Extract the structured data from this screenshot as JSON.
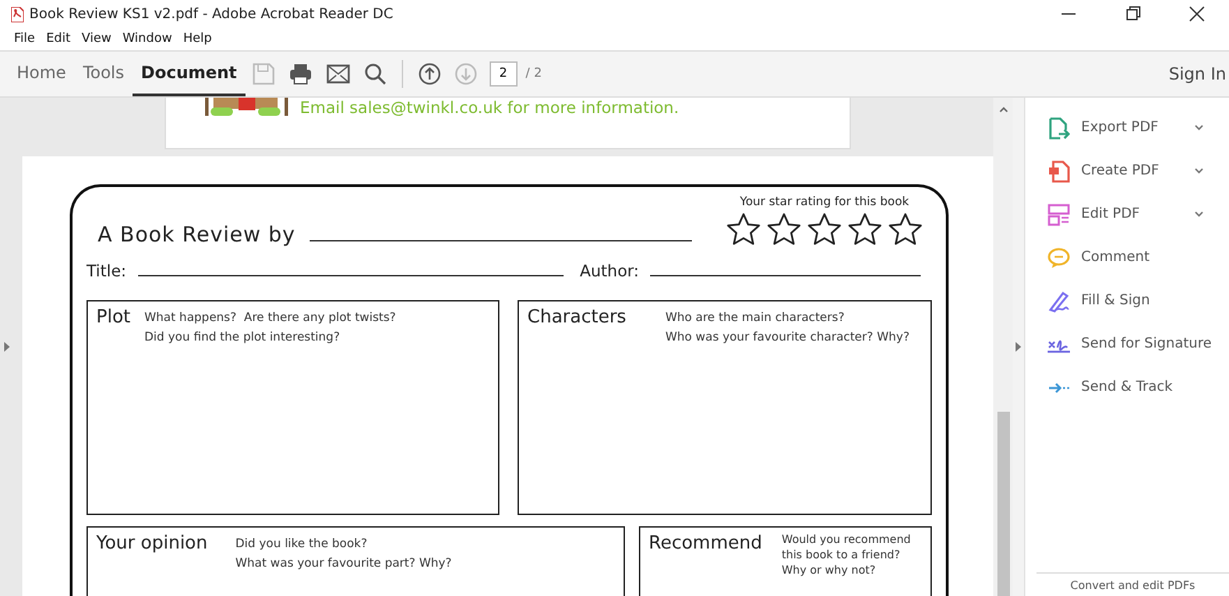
{
  "window": {
    "title": "Book Review KS1 v2.pdf - Adobe Acrobat Reader DC"
  },
  "menu": [
    "File",
    "Edit",
    "View",
    "Window",
    "Help"
  ],
  "tabs": [
    {
      "label": "Home",
      "selected": false
    },
    {
      "label": "Tools",
      "selected": false
    },
    {
      "label": "Document",
      "selected": true
    }
  ],
  "page_nav": {
    "current": "2",
    "total": "/ 2"
  },
  "sign_in": "Sign In",
  "previous_page": {
    "text": "Email sales@twinkl.co.uk for more information."
  },
  "review_sheet": {
    "heading": "A Book Review by",
    "star_prompt": "Your star rating for this book",
    "stars": 0,
    "title_label": "Title:",
    "author_label": "Author:",
    "sections": [
      {
        "title": "Plot",
        "prompts": [
          "What happens?  Are there any plot twists?",
          "Did you find the plot interesting?"
        ]
      },
      {
        "title": "Characters",
        "prompts": [
          "Who are the main characters?",
          "Who was your favourite character? Why?"
        ]
      },
      {
        "title": "Your opinion",
        "prompts": [
          "Did you like the book?",
          "What was your favourite part? Why?"
        ]
      },
      {
        "title": "Recommend",
        "prompts": [
          "Would you recommend",
          "this book to a friend?",
          "Why or why not?"
        ]
      }
    ]
  },
  "tools_pane": {
    "items": [
      {
        "label": "Export PDF",
        "kind": "export",
        "color": "#2fa37f",
        "has_menu": true
      },
      {
        "label": "Create PDF",
        "kind": "create",
        "color": "#e8584b",
        "has_menu": true
      },
      {
        "label": "Edit PDF",
        "kind": "edit",
        "color": "#d55fd0",
        "has_menu": true
      },
      {
        "label": "Comment",
        "kind": "comment",
        "color": "#f0b429",
        "has_menu": false
      },
      {
        "label": "Fill & Sign",
        "kind": "sign",
        "color": "#7a6ff0",
        "has_menu": false
      },
      {
        "label": "Send for Signature",
        "kind": "signature",
        "color": "#6a63e0",
        "has_menu": false
      },
      {
        "label": "Send & Track",
        "kind": "track",
        "color": "#3b96d6",
        "has_menu": false
      }
    ],
    "footer": "Convert and edit PDFs"
  }
}
